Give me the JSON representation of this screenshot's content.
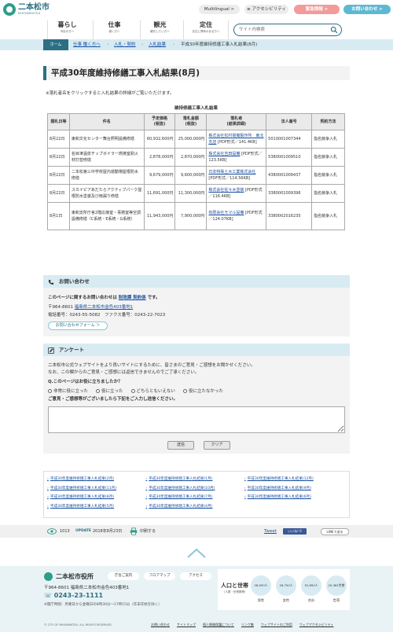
{
  "header": {
    "logo_main": "二本松市",
    "logo_sub": "NIHONMATSU",
    "multilingual": "Multilingual >",
    "accessibility": "≡ アクセシビリティ",
    "emergency": "緊急情報 >",
    "faq": "お問い合わせ >"
  },
  "gnav": [
    {
      "title": "暮らし",
      "sub": "市民の方へ"
    },
    {
      "title": "仕事",
      "sub": "働く方へ"
    },
    {
      "title": "観光",
      "sub": "観光したい方へ"
    },
    {
      "title": "定住",
      "sub": "定住に興味のある方へ"
    }
  ],
  "search": {
    "placeholder": "サイト内検索"
  },
  "breadcrumb": {
    "home": "ホーム",
    "items": [
      "仕事 働く方へ",
      "入札・契約",
      "入札結果"
    ],
    "current": "平成30年度維持修繕工事入札結果(8月)"
  },
  "page": {
    "title": "平成30年度維持修繕工事入札結果(8月)",
    "note": "※落札者名をクリックすると入札結果の詳細がご覧いただけます。",
    "table_caption": "維持修繕工事入札結果"
  },
  "table": {
    "headers": [
      "開札日等",
      "件名",
      "予定価格\n(税抜)",
      "落札金額\n(税抜)",
      "落札者\n(結果詳細)",
      "法人番号",
      "契約方法"
    ],
    "rows": [
      {
        "date": "8月22日",
        "name": "東和文化センター舞台照明設備修繕",
        "planned": "60,932,600円",
        "winning": "25,000,000円",
        "winner": "株式会社松村電機製作所　東北支店",
        "file": " [PDF形式／141.4KB]",
        "corp": "5010001007344",
        "method": "指名競争入札"
      },
      {
        "date": "8月22日",
        "name": "名目津温泉チップボイラー燃焼室耐火材打替修繕",
        "planned": "2,878,000円",
        "winning": "2,870,000円",
        "winner": "株式会社吉田設備",
        "file": " [PDF形式／123.5KB]",
        "corp": "5380001009510",
        "method": "指名競争入札"
      },
      {
        "date": "8月22日",
        "name": "二本松第三中学校屋内運動場屋根防水修繕",
        "planned": "9,679,000円",
        "winning": "9,600,000円",
        "winner": "日本特殊土木工業株式会社",
        "file": " [PDF形式／114.56KB]",
        "corp": "4380001009437",
        "method": "指名競争入札"
      },
      {
        "date": "8月22日",
        "name": "スカイピアあだたらアクティブパーク屋根防水塗装及び雨漏り修繕",
        "planned": "11,691,000円",
        "winning": "11,300,000円",
        "winner": "株式会社佐々木塗装",
        "file": " [PDF形式／116.4KB]",
        "corp": "3380001009396",
        "method": "指名競争入札"
      },
      {
        "date": "8月1日",
        "name": "東和支所庁舎2階応接室・事務室等空調設備修繕（C系統・E系統・G系統）",
        "planned": "11,943,000円",
        "winning": "7,900,000円",
        "winner": "有限会社モマル設備",
        "file": " [PDF形式／124.07KB]",
        "corp": "3380002016235",
        "method": "指名競争入札"
      }
    ]
  },
  "contact": {
    "heading": "お問い合わせ",
    "lead_pre": "このページに関するお問い合わせは ",
    "dept": "財政課 契約係",
    "lead_post": " です。",
    "postal": "〒964-8601",
    "address": "福島県二本松市金色403番地1",
    "tel": "電話番号：0243-55-5082　ファクス番号：0243-22-7023",
    "form_button": "お問い合わせフォーム ＞"
  },
  "survey": {
    "heading": "アンケート",
    "p1": "二本松市公式ウェブサイトをより良いサイトにするために、皆さまのご意見・ご感想をお聞かせください。",
    "p2": "なお、この欄からのご意見・ご感想には返信できませんのでご了承ください。",
    "question": "Q.このページはお役に立ちましたか？",
    "options": [
      "非常に役に立った",
      "役に立った",
      "どちらともいえない",
      "役に立たなかった"
    ],
    "free_label": "ご意見・ご感想等がございましたら下記をご入力し送信ください。",
    "submit": "送信",
    "clear": "クリア"
  },
  "related": [
    "平成30年度維持修繕工事入札結果(2月)",
    "平成30年度維持修繕工事入札結果(1月)",
    "平成30年度維持修繕工事入札結果(12月)",
    "平成30年度維持修繕工事入札結果(11月)",
    "平成30年度維持修繕工事入札結果(10月)",
    "平成30年度維持修繕工事入札結果(9月)",
    "平成30年度維持修繕工事入札結果(8月)",
    "平成30年度維持修繕工事入札結果(7月)",
    "平成30年度維持修繕工事入札結果(6月)",
    "平成30年度維持修繕工事入札結果(5月)",
    "平成30年度維持修繕工事入札結果(4月)"
  ],
  "utility": {
    "count": "1013",
    "update_label": "UPDATE",
    "update_date": "2018年8月23日",
    "print": "印刷する",
    "tweet": "Tweet",
    "like": "いいね! 0",
    "line": "LINEで送る"
  },
  "footer": {
    "name": "二本松市役所",
    "pills": [
      "庁舎ご案内",
      "フロアマップ",
      "アクセス"
    ],
    "address": "〒964-8601 福島県二本松市金色403番地1",
    "tel": "0243-23-1111",
    "hours": "※開庁時間：月曜日から金曜日の8時30分～17時15分（年末年始を除く）",
    "pop_title": "人口と世帯",
    "pop_sub": "（人数・世帯数等）",
    "pop": [
      {
        "value": "26,950人",
        "label": "男性"
      },
      {
        "value": "26,750人",
        "label": "女性"
      },
      {
        "value": "52,892人",
        "label": "合計"
      },
      {
        "value": "20,361世帯",
        "label": "世帯"
      }
    ],
    "copyright": "© CITY OF NIHONMATSU. ALL RIGHTS RESERVED.",
    "links": [
      "お問い合わせ",
      "サイトマップ",
      "個人情報保護について",
      "リンク集",
      "ウェブサイトのご利用",
      "ウェブアクセシビリティ"
    ]
  }
}
